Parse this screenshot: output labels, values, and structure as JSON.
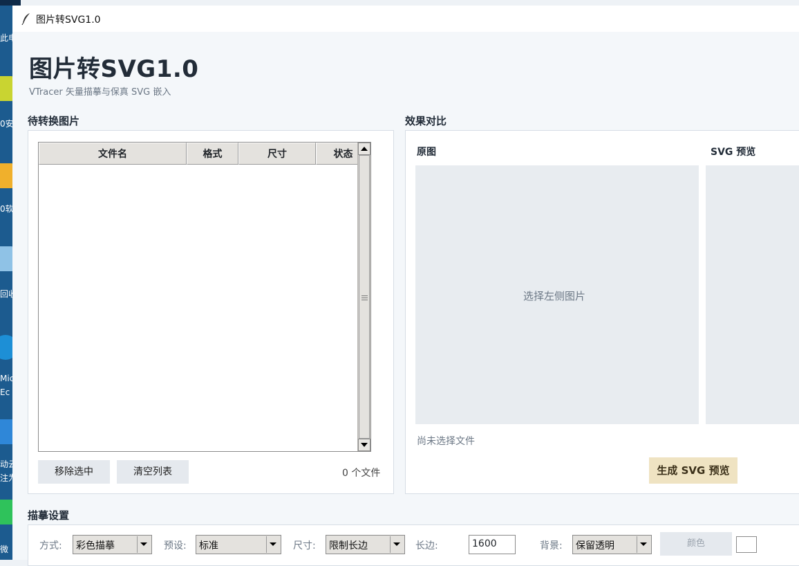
{
  "window": {
    "title": "图片转SVG1.0"
  },
  "header": {
    "title": "图片转SVG1.0",
    "subtitle": "VTracer 矢量描摹与保真 SVG 嵌入"
  },
  "file_section": {
    "title": "待转换图片",
    "columns": [
      "文件名",
      "格式",
      "尺寸",
      "状态"
    ],
    "rows": [],
    "remove_label": "移除选中",
    "clear_label": "清空列表",
    "count_text": "0 个文件"
  },
  "compare_section": {
    "title": "效果对比",
    "original_label": "原图",
    "svg_label": "SVG 预览",
    "placeholder": "选择左侧图片",
    "status": "尚未选择文件",
    "generate_label": "生成 SVG 预览"
  },
  "settings": {
    "title": "描摹设置",
    "mode_label": "方式:",
    "mode_value": "彩色描摹",
    "preset_label": "预设:",
    "preset_value": "标准",
    "size_label": "尺寸:",
    "size_value": "限制长边",
    "edge_label": "长边:",
    "edge_value": "1600",
    "bg_label": "背景:",
    "bg_value": "保留透明",
    "color_label": "颜色"
  },
  "desktop": {
    "labels": [
      "此电",
      "0安",
      "0软",
      "回收",
      "Micr",
      "Ec",
      "动云",
      "注为",
      "微"
    ]
  },
  "colors": {
    "accent_button": "#efe3c2",
    "panel_bg": "#ffffff",
    "preview_bg": "#e8ecf0"
  }
}
